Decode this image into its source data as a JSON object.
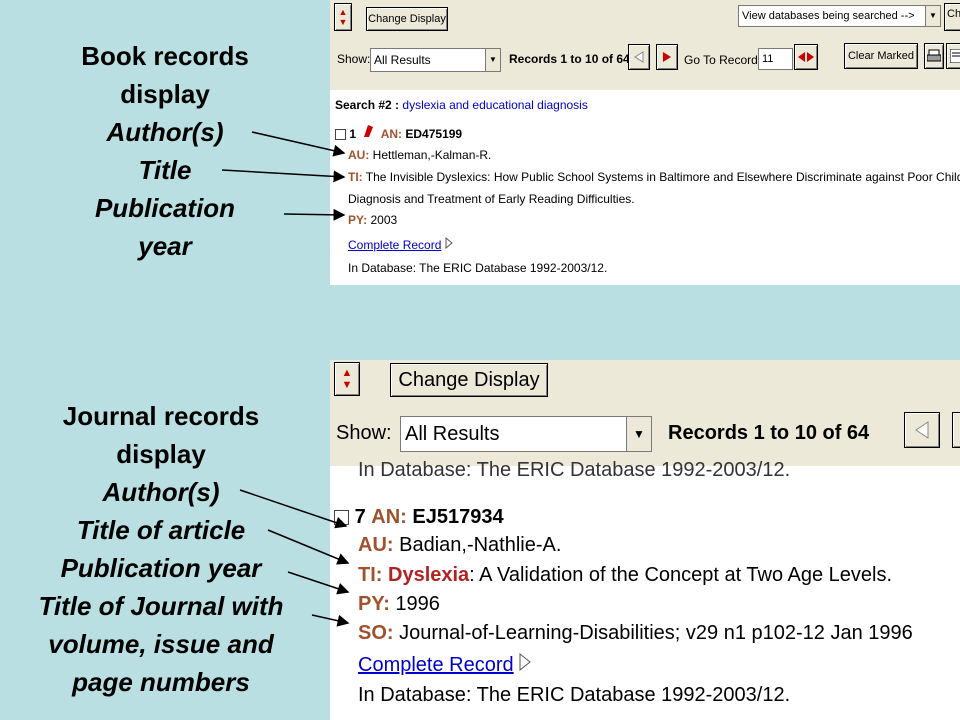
{
  "book_labels": {
    "heading_1": "Book records",
    "heading_2": "display",
    "author": "Author(s)",
    "title": "Title",
    "pubyear_1": "Publication",
    "pubyear_2": "year"
  },
  "journal_labels": {
    "heading_1": "Journal records",
    "heading_2": "display",
    "author": "Author(s)",
    "title_article": "Title of article",
    "pubyear": "Publication year",
    "journal_1": "Title of Journal with",
    "journal_2": "volume, issue and",
    "journal_3": "page numbers"
  },
  "book_panel": {
    "change_display": "Change Display",
    "clipped_button": "Ch",
    "view_databases": "View databases being searched -->",
    "show_label": "Show:",
    "show_value": "All Results",
    "records": "Records 1 to 10 of 64",
    "goto_label": "Go To Record:",
    "goto_value": "11",
    "clear_marked": "Clear Marked",
    "search_prefix": "Search #2 :",
    "search_terms": "dyslexia and educational diagnosis",
    "record_number": "1",
    "an_label": "AN:",
    "an_value": "ED475199",
    "au_label": "AU:",
    "au_value": "Hettleman,-Kalman-R.",
    "ti_label": "TI:",
    "ti_value_1": "The Invisible Dyslexics: How Public School Systems in Baltimore and Elsewhere Discriminate against Poor Children in the",
    "ti_value_2": "Diagnosis and Treatment of Early Reading Difficulties.",
    "py_label": "PY:",
    "py_value": "2003",
    "complete_record": "Complete Record",
    "in_database": "In Database: The ERIC Database 1992-2003/12."
  },
  "journal_panel": {
    "change_display": "Change Display",
    "show_label": "Show:",
    "show_value": "All Results",
    "records": "Records 1 to 10 of 64",
    "clipped_text": "In Database: The ERIC Database 1992-2003/12.",
    "record_number": "7",
    "an_label": "AN:",
    "an_value": "EJ517934",
    "au_label": "AU:",
    "au_value": "Badian,-Nathlie-A.",
    "ti_label": "TI:",
    "ti_highlight": "Dyslexia",
    "ti_value": ": A Validation of the Concept at Two Age Levels.",
    "py_label": "PY:",
    "py_value": "1996",
    "so_label": "SO:",
    "so_value": "Journal-of-Learning-Disabilities; v29 n1 p102-12 Jan 1996",
    "complete_record": "Complete Record",
    "in_database": "In Database: The ERIC Database 1992-2003/12."
  },
  "colors": {
    "background": "#b9dfe2",
    "field_label": "#a0522d",
    "link": "#0000cc",
    "highlight": "#b22222"
  }
}
